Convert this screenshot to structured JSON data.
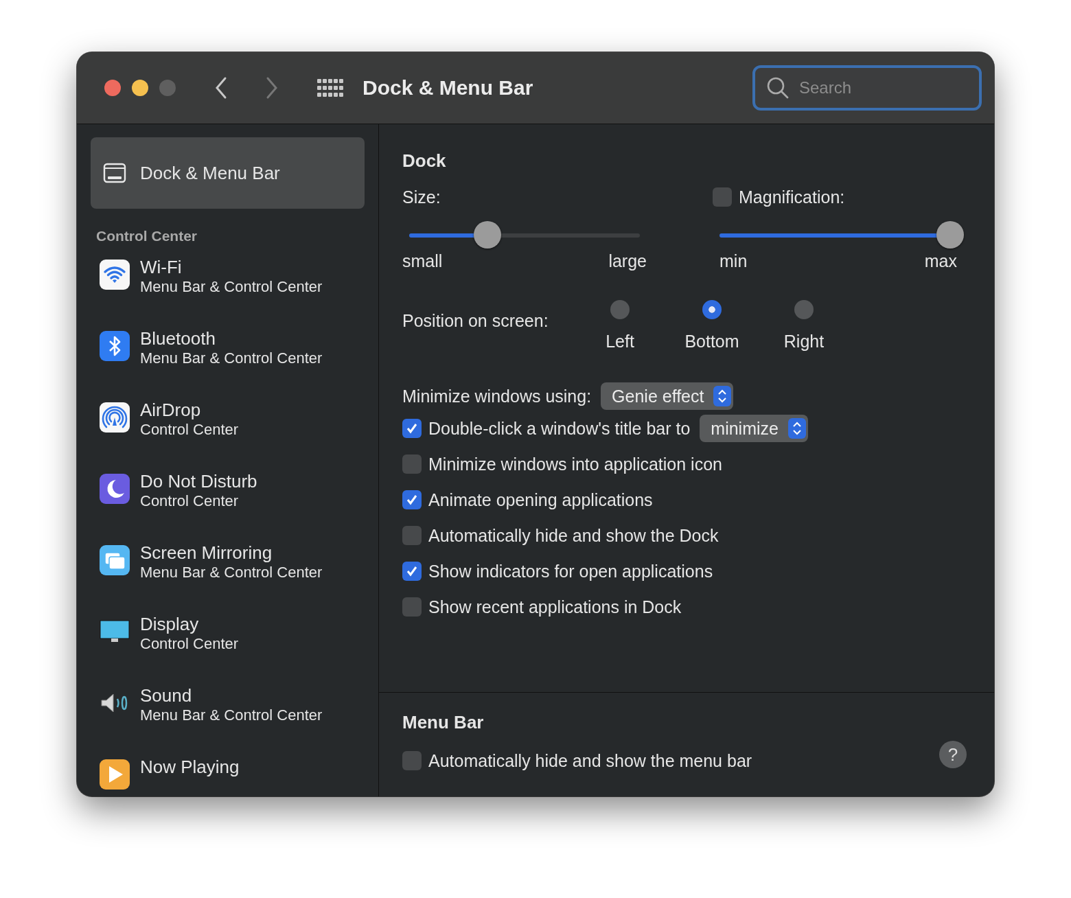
{
  "window": {
    "title": "Dock & Menu Bar"
  },
  "search": {
    "placeholder": "Search"
  },
  "sidebar": {
    "items": [
      {
        "title": "Dock & Menu Bar",
        "selected": true
      }
    ],
    "section": "Control Center",
    "control_center_items": [
      {
        "title": "Wi-Fi",
        "subtitle": "Menu Bar & Control Center",
        "selected": false
      },
      {
        "title": "Bluetooth",
        "subtitle": "Menu Bar & Control Center",
        "selected": false
      },
      {
        "title": "AirDrop",
        "subtitle": "Control Center",
        "selected": false
      },
      {
        "title": "Do Not Disturb",
        "subtitle": "Control Center",
        "selected": false
      },
      {
        "title": "Screen Mirroring",
        "subtitle": "Menu Bar & Control Center",
        "selected": false
      },
      {
        "title": "Display",
        "subtitle": "Control Center",
        "selected": false
      },
      {
        "title": "Sound",
        "subtitle": "Menu Bar & Control Center",
        "selected": false
      },
      {
        "title": "Now Playing",
        "selected": false
      }
    ]
  },
  "dock": {
    "title": "Dock",
    "size": {
      "label": "Size:",
      "level": 0.34,
      "min_label": "small",
      "max_label": "large"
    },
    "magnification": {
      "label": "Magnification:",
      "checked": false,
      "level": 1.0,
      "min_label": "min",
      "max_label": "max"
    },
    "position": {
      "label": "Position on screen:",
      "options": [
        {
          "label": "Left",
          "selected": false
        },
        {
          "label": "Bottom",
          "selected": true
        },
        {
          "label": "Right",
          "selected": false
        }
      ]
    },
    "minimize": {
      "label": "Minimize windows using:",
      "value": "Genie effect"
    },
    "options": [
      {
        "kind": "select",
        "label": "Double-click a window's title bar to",
        "checked": true,
        "value": "minimize"
      },
      {
        "kind": "checkbox",
        "label": "Minimize windows into application icon",
        "checked": false
      },
      {
        "kind": "checkbox",
        "label": "Animate opening applications",
        "checked": true
      },
      {
        "kind": "checkbox",
        "label": "Automatically hide and show the Dock",
        "checked": false
      },
      {
        "kind": "checkbox",
        "label": "Show indicators for open applications",
        "checked": true
      },
      {
        "kind": "checkbox",
        "label": "Show recent applications in Dock",
        "checked": false
      }
    ]
  },
  "menu_bar": {
    "title": "Menu Bar",
    "options": [
      {
        "label": "Automatically hide and show the menu bar",
        "checked": false
      }
    ],
    "help": "?"
  }
}
